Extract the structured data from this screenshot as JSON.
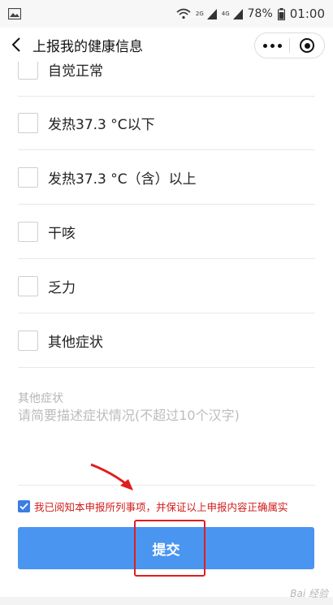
{
  "status_bar": {
    "signal_badge_1": "2G",
    "signal_badge_2": "4G",
    "battery": "78%",
    "time": "01:00"
  },
  "header": {
    "title": "上报我的健康信息"
  },
  "options": [
    {
      "label": "自觉正常",
      "checked": false
    },
    {
      "label": "发热37.3 °C以下",
      "checked": false
    },
    {
      "label": "发热37.3 °C（含）以上",
      "checked": false
    },
    {
      "label": "干咳",
      "checked": false
    },
    {
      "label": "乏力",
      "checked": false
    },
    {
      "label": "其他症状",
      "checked": false
    }
  ],
  "other_symptoms": {
    "title": "其他症状",
    "placeholder": "请简要描述症状情况(不超过10个汉字)",
    "value": ""
  },
  "agreement": {
    "checked": true,
    "text": "我已阅知本申报所列事项，并保证以上申报内容正确属实"
  },
  "submit": {
    "label": "提交"
  },
  "annotations": {
    "highlight_color": "#e01e1e",
    "accent_color": "#4a95f0"
  },
  "watermark": {
    "text": "Bai 经验"
  }
}
